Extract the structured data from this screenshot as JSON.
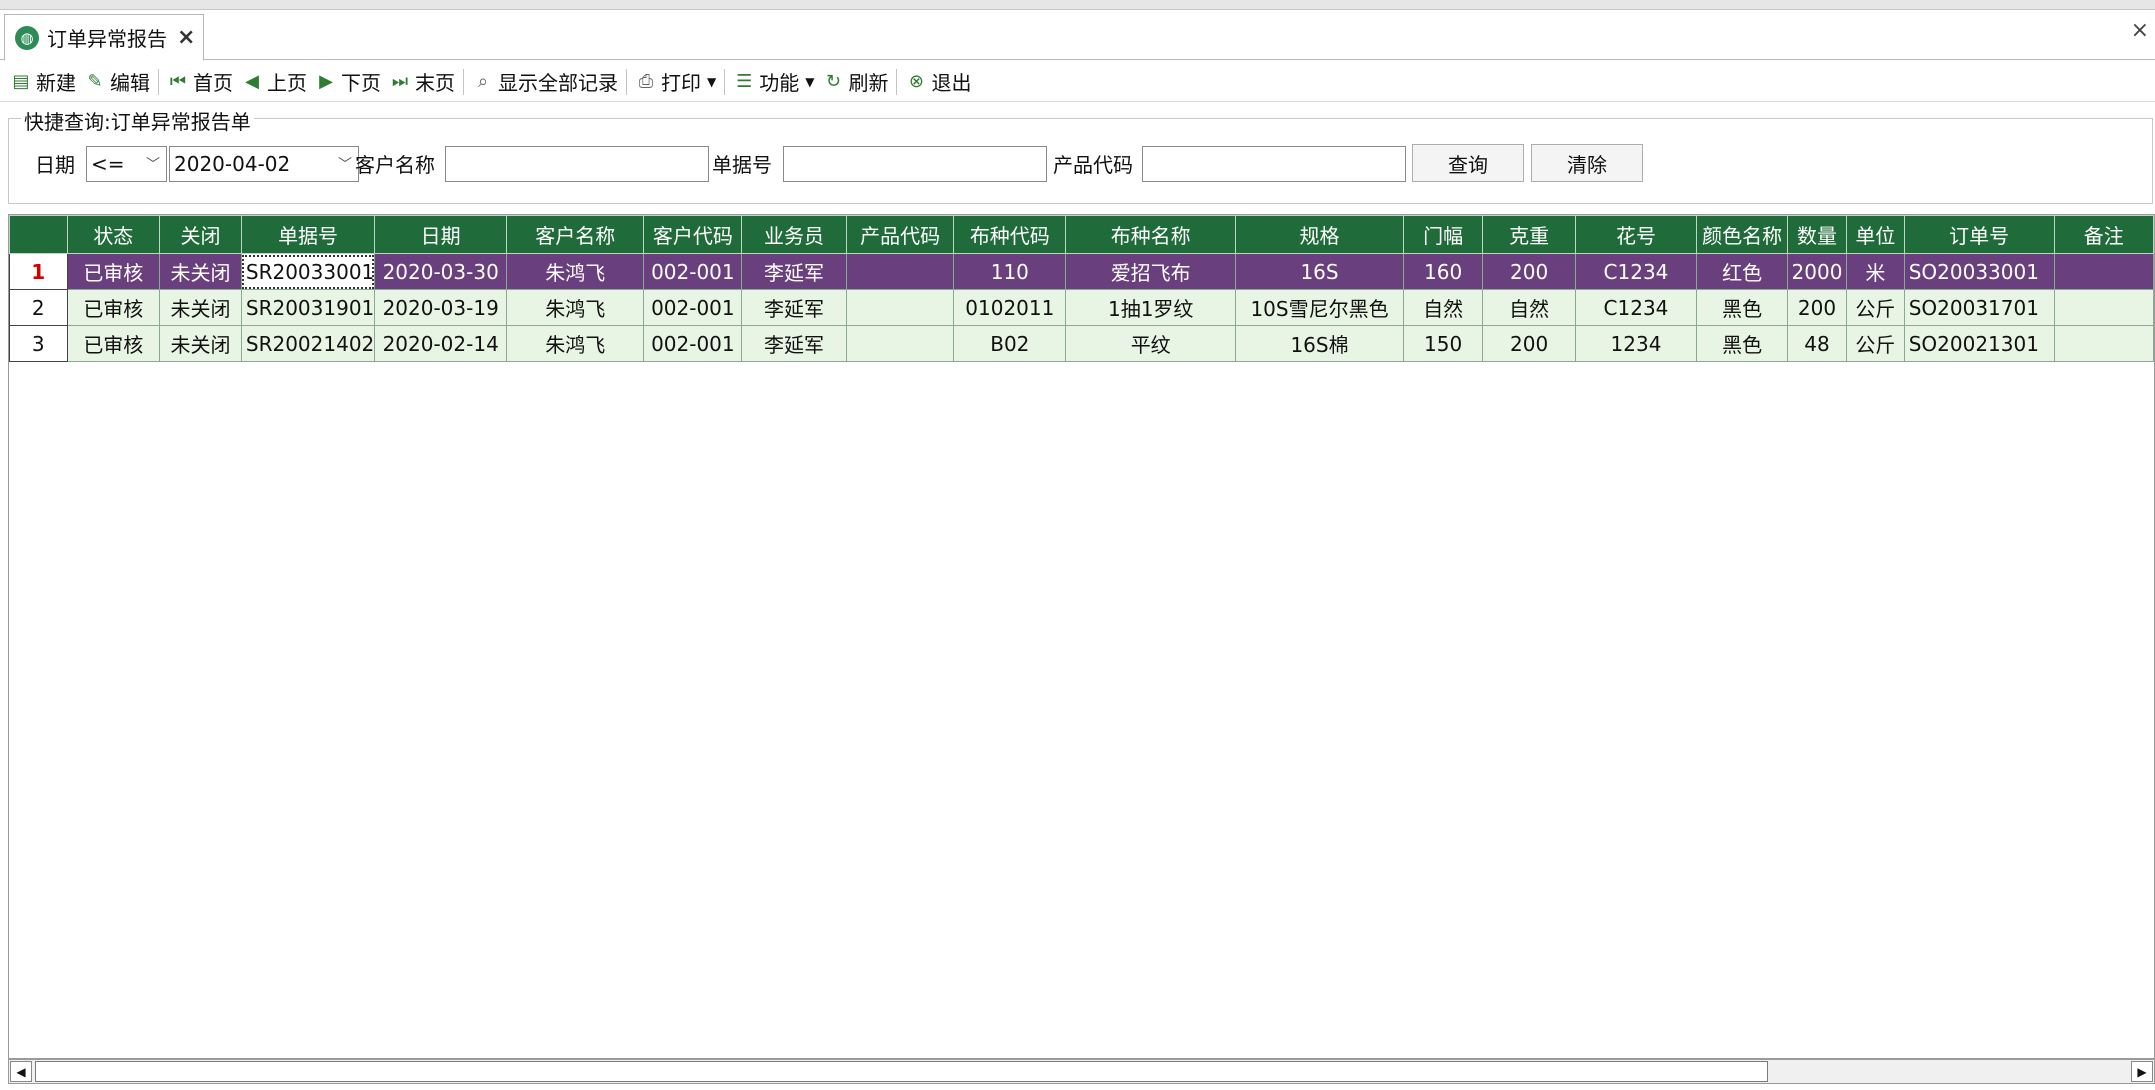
{
  "tab": {
    "title": "订单异常报告",
    "close": "×"
  },
  "window": {
    "close": "×"
  },
  "toolbar": {
    "new": "新建",
    "edit": "编辑",
    "first": "首页",
    "prev": "上页",
    "next": "下页",
    "last": "末页",
    "show_all": "显示全部记录",
    "print": "打印",
    "functions": "功能",
    "refresh": "刷新",
    "exit": "退出"
  },
  "quick_search": {
    "legend": "快捷查询:订单异常报告单",
    "date_label": "日期",
    "operator": "<=",
    "date_value": "2020-04-02",
    "customer_label": "客户名称",
    "customer_value": "",
    "doc_no_label": "单据号",
    "doc_no_value": "",
    "product_code_label": "产品代码",
    "product_code_value": "",
    "query_button": "查询",
    "clear_button": "清除"
  },
  "grid": {
    "columns": [
      "状态",
      "关闭",
      "单据号",
      "日期",
      "客户名称",
      "客户代码",
      "业务员",
      "产品代码",
      "布种代码",
      "布种名称",
      "规格",
      "门幅",
      "克重",
      "花号",
      "颜色名称",
      "数量",
      "单位",
      "订单号",
      "备注"
    ],
    "rows": [
      {
        "num": "1",
        "cells": [
          "已审核",
          "未关闭",
          "SR20033001",
          "2020-03-30",
          "朱鸿飞",
          "002-001",
          "李延军",
          "",
          "110",
          "爱招飞布",
          "16S",
          "160",
          "200",
          "C1234",
          "红色",
          "2000",
          "米",
          "SO20033001",
          ""
        ]
      },
      {
        "num": "2",
        "cells": [
          "已审核",
          "未关闭",
          "SR20031901",
          "2020-03-19",
          "朱鸿飞",
          "002-001",
          "李延军",
          "",
          "0102011",
          "1抽1罗纹",
          "10S雪尼尔黑色",
          "自然",
          "自然",
          "C1234",
          "黑色",
          "200",
          "公斤",
          "SO20031701",
          ""
        ]
      },
      {
        "num": "3",
        "cells": [
          "已审核",
          "未关闭",
          "SR20021402",
          "2020-02-14",
          "朱鸿飞",
          "002-001",
          "李延军",
          "",
          "B02",
          "平纹",
          "16S棉",
          "150",
          "200",
          "1234",
          "黑色",
          "48",
          "公斤",
          "SO20021301",
          ""
        ]
      }
    ]
  },
  "icons": {
    "tab": "globe-icon",
    "new": "document-icon",
    "edit": "pencil-icon",
    "first": "first-page-icon",
    "prev": "prev-page-icon",
    "next": "next-page-icon",
    "last": "last-page-icon",
    "show_all": "magnifier-icon",
    "print": "printer-icon",
    "functions": "list-icon",
    "refresh": "refresh-icon",
    "exit": "exit-icon"
  },
  "colors": {
    "header": "#1f6b3a",
    "selected_row": "#6a3f7d",
    "normal_row": "#e9f5e4",
    "active_row_number": "#d40000"
  }
}
